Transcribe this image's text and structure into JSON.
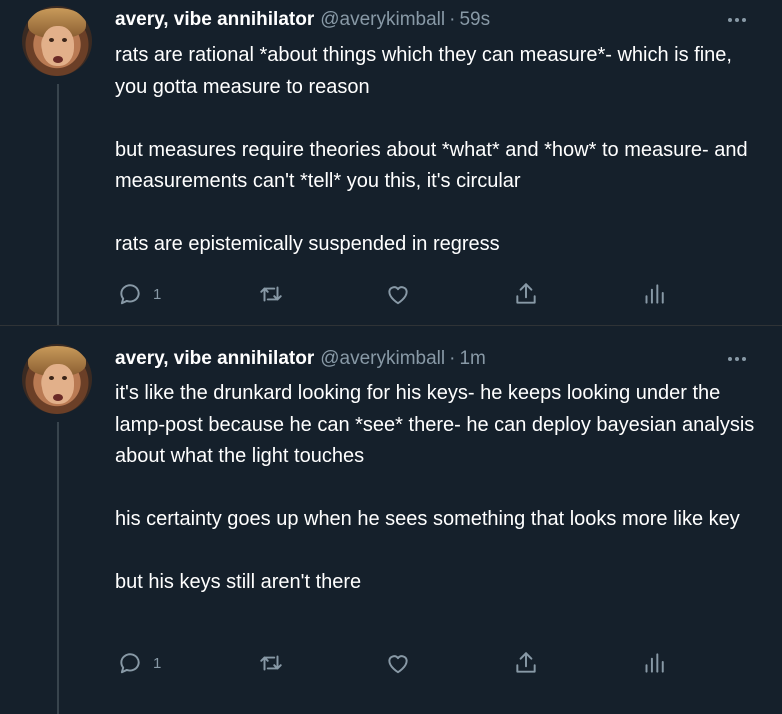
{
  "tweets": [
    {
      "display_name": "avery, vibe annihilator",
      "handle": "@averykimball",
      "separator": "·",
      "time": "59s",
      "paragraphs": [
        "rats are rational *about things which they can measure*- which is fine, you gotta measure to reason",
        "but measures require theories about *what* and *how* to measure- and measurements can't *tell* you this, it's circular",
        "rats are epistemically suspended in regress"
      ],
      "reply_count": "1"
    },
    {
      "display_name": "avery, vibe annihilator",
      "handle": "@averykimball",
      "separator": "·",
      "time": "1m",
      "paragraphs": [
        "it's like the drunkard looking for his keys- he keeps looking under the lamp-post because he can *see* there- he can deploy bayesian analysis about what the light touches",
        "his certainty goes up when he sees something that looks more like key",
        "but his keys still aren't there"
      ],
      "reply_count": "1"
    }
  ],
  "icons": [
    "reply-icon",
    "retweet-icon",
    "like-icon",
    "share-icon",
    "analytics-icon",
    "more-icon"
  ],
  "colors": {
    "background": "#15202b",
    "text": "#ffffff",
    "secondary": "#8899a6",
    "thread_line": "#38444d"
  }
}
